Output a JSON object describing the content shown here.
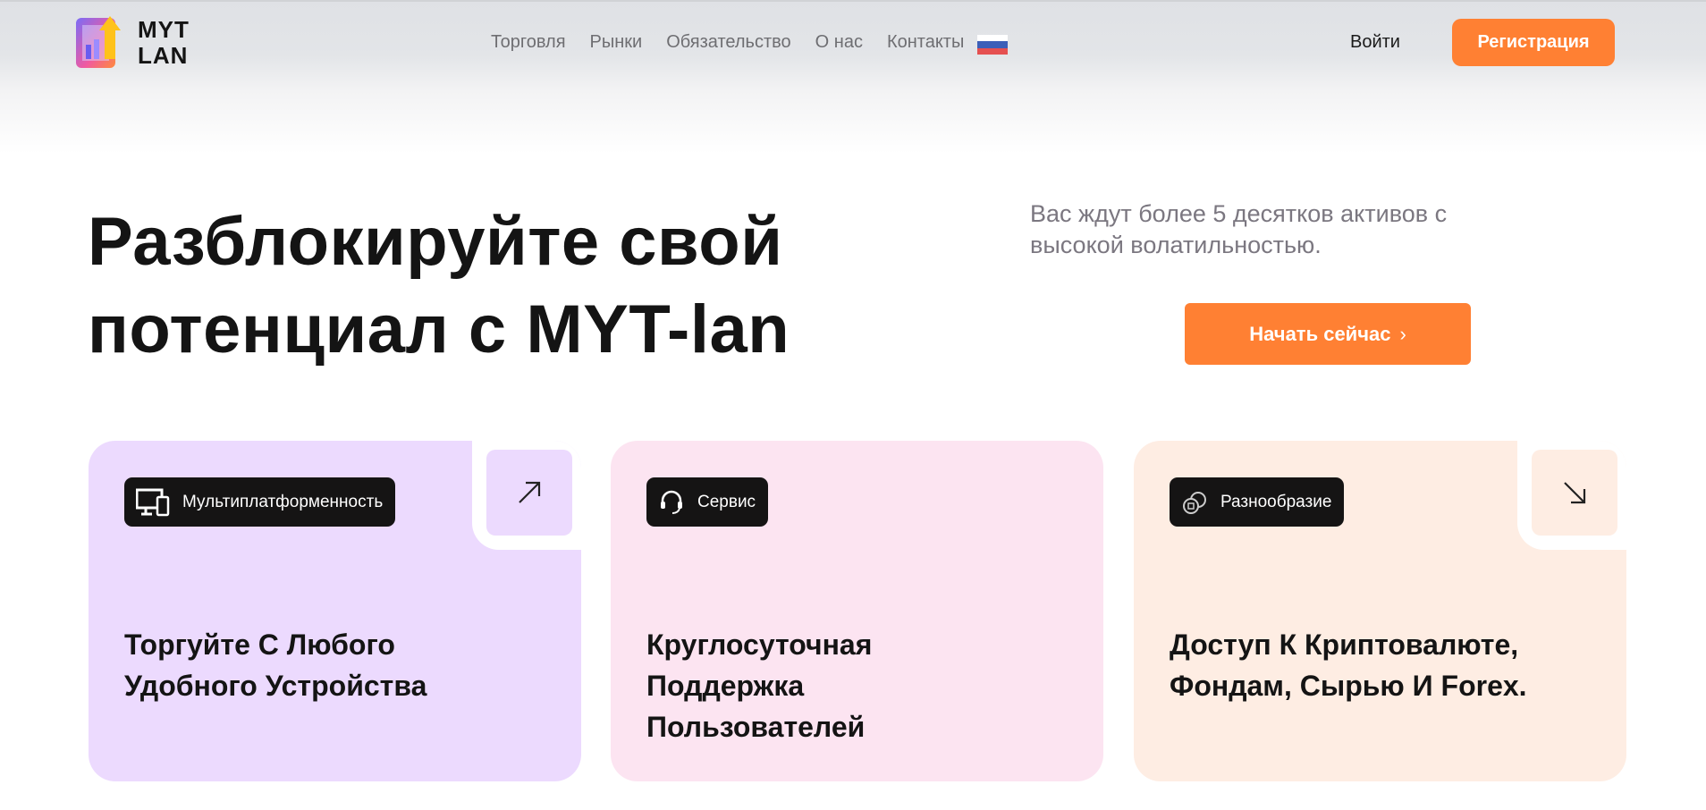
{
  "header": {
    "logo_text": [
      "MYT",
      "LAN"
    ],
    "nav": [
      "Торговля",
      "Рынки",
      "Обязательство",
      "О нас",
      "Контакты"
    ],
    "language": "ru",
    "login": "Войти",
    "register": "Регистрация"
  },
  "hero": {
    "title_lines": [
      "Разблокируйте свой",
      "потенциал с MYT-lan"
    ],
    "subtitle": "Вас ждут более 5 десятков активов с высокой волатильностью.",
    "cta": "Начать сейчас"
  },
  "cards": [
    {
      "tag": "Мультиплатформенность",
      "title": "Торгуйте С Любого Удобного Устройства",
      "color": "#ecdafe",
      "icon": "devices-icon",
      "arrow": "arrow-up-right-icon"
    },
    {
      "tag": "Сервис",
      "title": "Круглосуточная Поддержка Пользователей",
      "color": "#fce4f1",
      "icon": "headset-icon"
    },
    {
      "tag": "Разнообразие",
      "title": "Доступ К Криптовалюте, Фондам, Сырью И Forex.",
      "color": "#feede3",
      "icon": "coins-icon",
      "arrow": "arrow-down-right-icon"
    }
  ],
  "colors": {
    "accent": "#ff8033"
  }
}
